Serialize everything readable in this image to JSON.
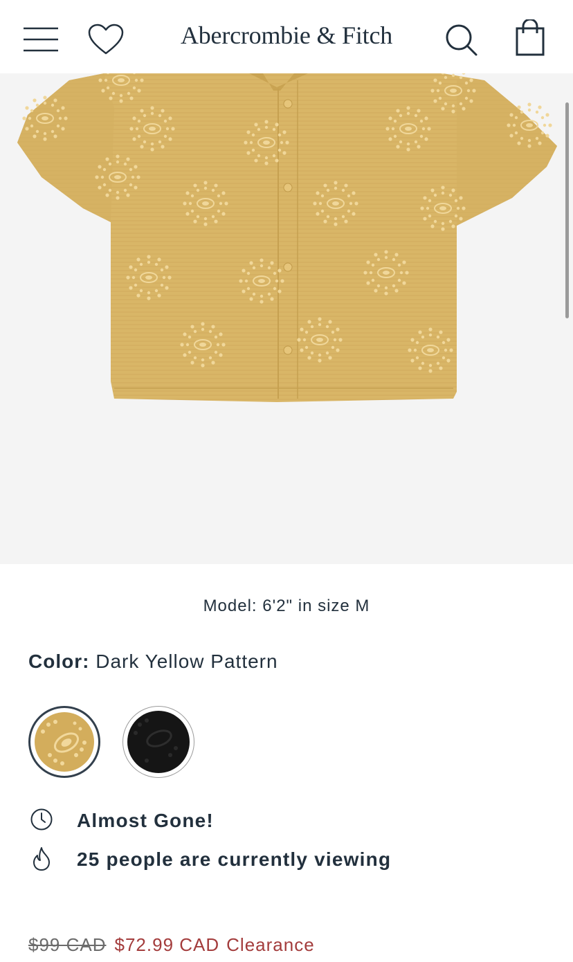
{
  "header": {
    "brand": "Abercrombie & Fitch",
    "icons": [
      "menu-icon",
      "heart-icon",
      "search-icon",
      "shopping-bag-icon"
    ]
  },
  "product_image": {
    "alt": "Dark Yellow Pattern camp collar shirt",
    "shirt_color": "#d9b667",
    "background": "#f4f4f4"
  },
  "model_note": "Model: 6'2\" in size M",
  "color": {
    "label": "Color:",
    "value": "Dark Yellow Pattern",
    "swatches": [
      {
        "name": "Dark Yellow Pattern",
        "hex": "#d3ad5c",
        "selected": true
      },
      {
        "name": "Black Pattern",
        "hex": "#151515",
        "selected": false
      }
    ]
  },
  "status": {
    "stock": "Almost Gone!",
    "viewers": "25 people are currently viewing",
    "icons": [
      "clock-icon",
      "flame-icon"
    ]
  },
  "price": {
    "original": "$99 CAD",
    "sale": "$72.99 CAD",
    "tag": "Clearance"
  }
}
